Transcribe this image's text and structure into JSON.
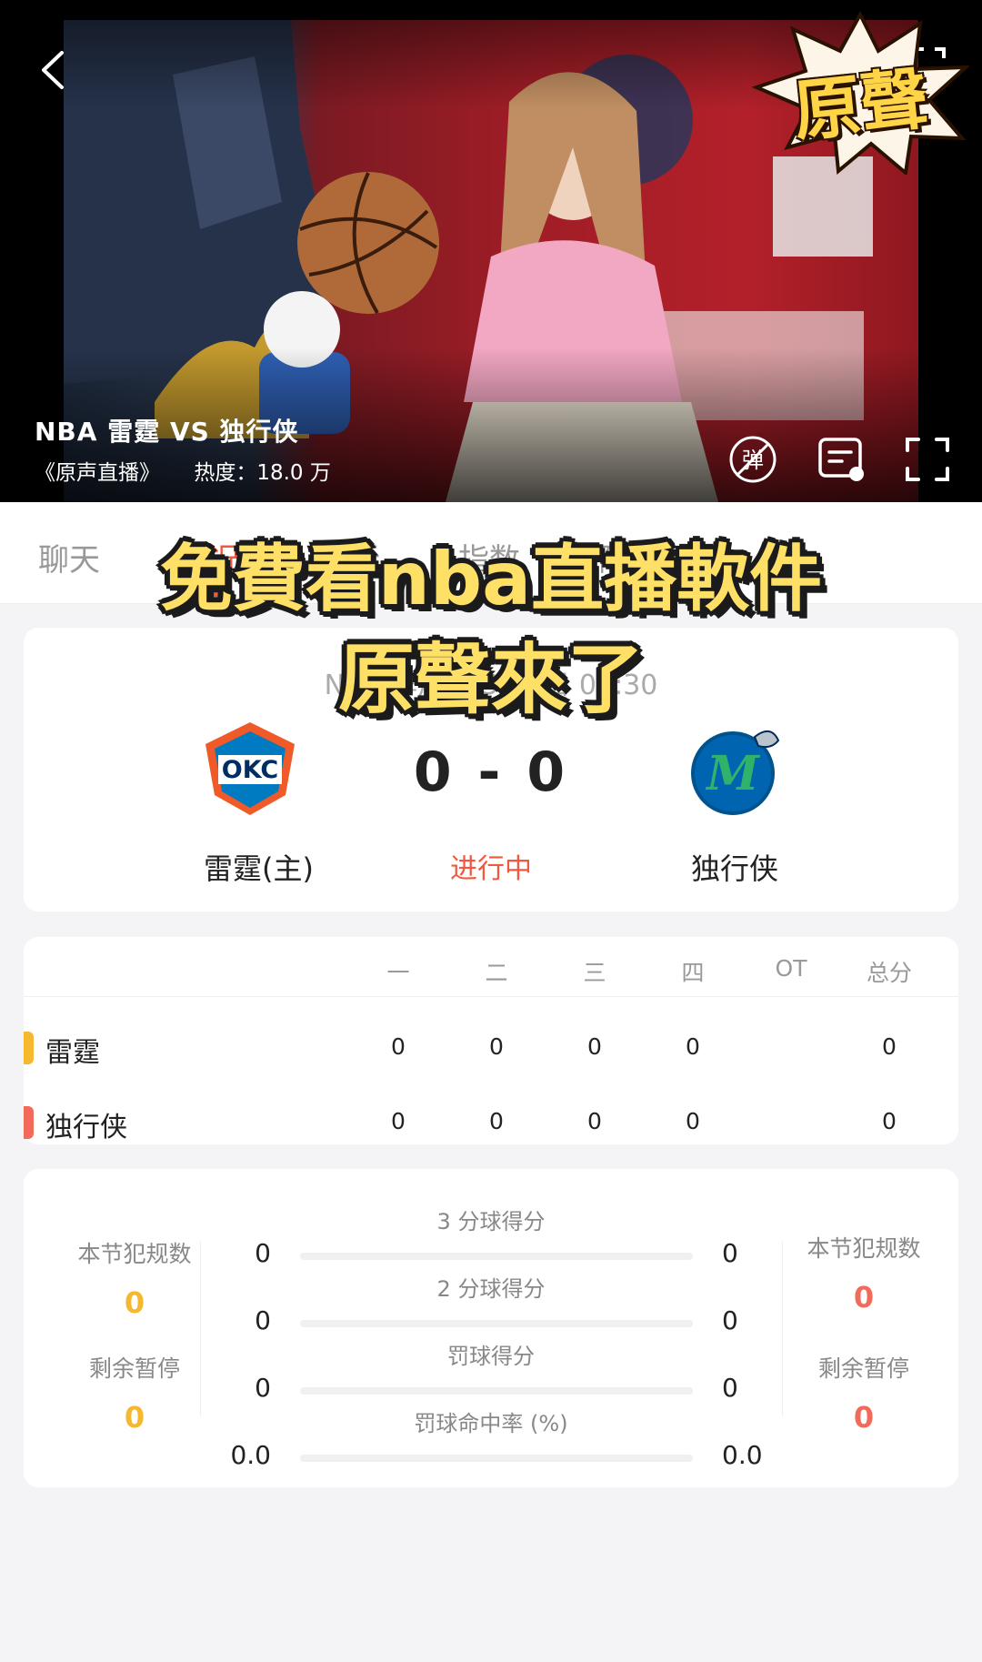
{
  "video": {
    "title": "NBA 雷霆 VS 独行侠",
    "program": "《原声直播》",
    "heat": "热度：18.0 万",
    "badge": "原聲",
    "danmaku_label": "弹"
  },
  "tabs": [
    "聊天",
    "赛况",
    "分析",
    "指数",
    "阵容"
  ],
  "active_tab": 1,
  "caption": {
    "line1": "免費看nba直播軟件",
    "line2": "原聲來了"
  },
  "match": {
    "info": "NBA 季后赛 5月8日 09:30",
    "home_team": "雷霆(主)",
    "away_team": "独行侠",
    "score": "0 - 0",
    "status": "进行中",
    "home_logo": "OKC",
    "away_logo": "M"
  },
  "quarter_table": {
    "headers": [
      "一",
      "二",
      "三",
      "四",
      "OT",
      "总分"
    ],
    "rows": [
      {
        "team": "雷霆",
        "color": "#f5b82e",
        "values": [
          "0",
          "0",
          "0",
          "0",
          "",
          "0"
        ]
      },
      {
        "team": "独行侠",
        "color": "#f26a5a",
        "values": [
          "0",
          "0",
          "0",
          "0",
          "",
          "0"
        ]
      }
    ]
  },
  "stats": {
    "home": {
      "fouls_label": "本节犯规数",
      "fouls": "0",
      "timeouts_label": "剩余暂停",
      "timeouts": "0",
      "color": "#f5b82e"
    },
    "away": {
      "fouls_label": "本节犯规数",
      "fouls": "0",
      "timeouts_label": "剩余暂停",
      "timeouts": "0",
      "color": "#f26a5a"
    },
    "rows": [
      {
        "label": "3 分球得分",
        "home": "0",
        "away": "0"
      },
      {
        "label": "2 分球得分",
        "home": "0",
        "away": "0"
      },
      {
        "label": "罚球得分",
        "home": "0",
        "away": "0"
      },
      {
        "label": "罚球命中率 (%)",
        "home": "0.0",
        "away": "0.0"
      }
    ]
  }
}
